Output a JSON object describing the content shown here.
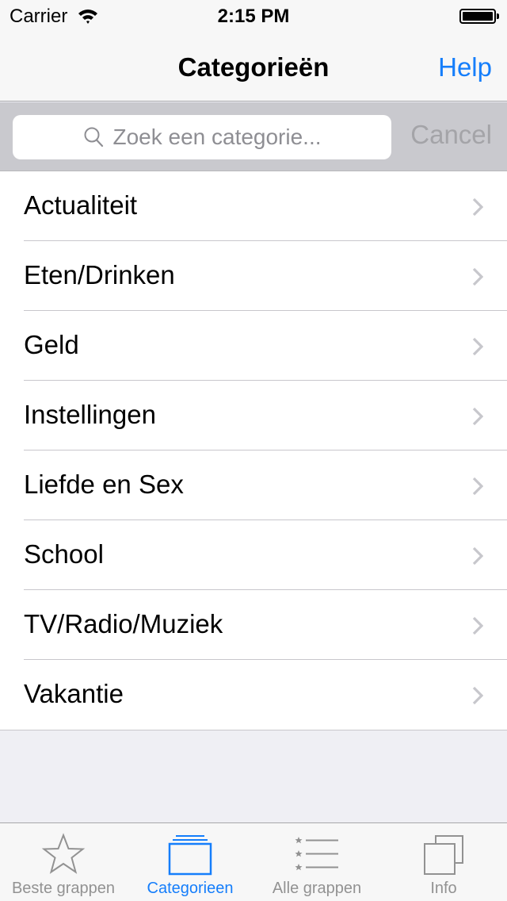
{
  "statusbar": {
    "carrier": "Carrier",
    "time": "2:15 PM",
    "wifi_icon": "wifi-icon",
    "battery_icon": "battery-icon",
    "battery_level": 1.0
  },
  "navbar": {
    "title": "Categorieën",
    "right_button": "Help"
  },
  "search": {
    "placeholder": "Zoek een categorie...",
    "value": "",
    "icon": "search-icon",
    "cancel_label": "Cancel"
  },
  "categories": [
    {
      "label": "Actualiteit"
    },
    {
      "label": "Eten/Drinken"
    },
    {
      "label": "Geld"
    },
    {
      "label": "Instellingen"
    },
    {
      "label": "Liefde en Sex"
    },
    {
      "label": "School"
    },
    {
      "label": "TV/Radio/Muziek"
    },
    {
      "label": "Vakantie"
    }
  ],
  "tabbar": {
    "tabs": [
      {
        "label": "Beste grappen",
        "icon": "star-icon",
        "active": false
      },
      {
        "label": "Categorieen",
        "icon": "folders-icon",
        "active": true
      },
      {
        "label": "Alle grappen",
        "icon": "starred-list-icon",
        "active": false
      },
      {
        "label": "Info",
        "icon": "copy-squares-icon",
        "active": false
      }
    ]
  },
  "colors": {
    "accent": "#157efb",
    "inactive_tab": "#929292",
    "chevron": "#c7c7cc",
    "search_bar_bg": "#c9c9ce",
    "grouped_bg": "#efeff4"
  }
}
